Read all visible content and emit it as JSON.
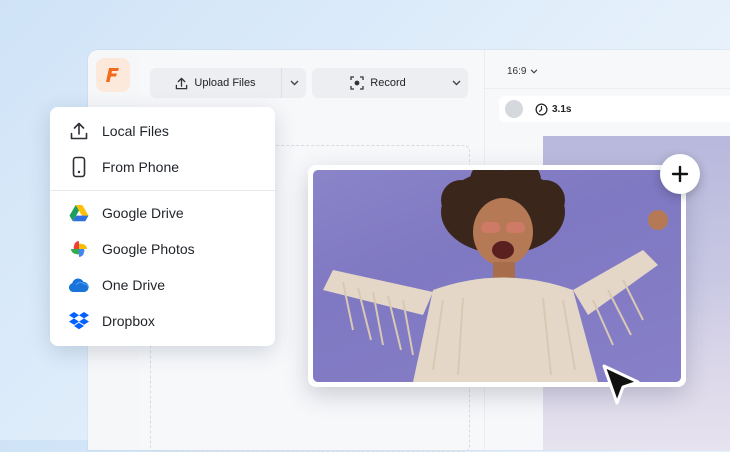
{
  "toolbar": {
    "upload_label": "Upload Files",
    "record_label": "Record"
  },
  "canvas": {
    "aspect_ratio": "16:9",
    "duration": "3.1s"
  },
  "upload_menu": {
    "items": [
      {
        "label": "Local Files",
        "icon": "upload-icon"
      },
      {
        "label": "From Phone",
        "icon": "phone-icon"
      },
      {
        "label": "Google Drive",
        "icon": "google-drive-icon"
      },
      {
        "label": "Google Photos",
        "icon": "google-photos-icon"
      },
      {
        "label": "One Drive",
        "icon": "onedrive-icon"
      },
      {
        "label": "Dropbox",
        "icon": "dropbox-icon"
      }
    ]
  },
  "colors": {
    "accent": "#f26a1b",
    "photo_background": "#8a84c9"
  }
}
